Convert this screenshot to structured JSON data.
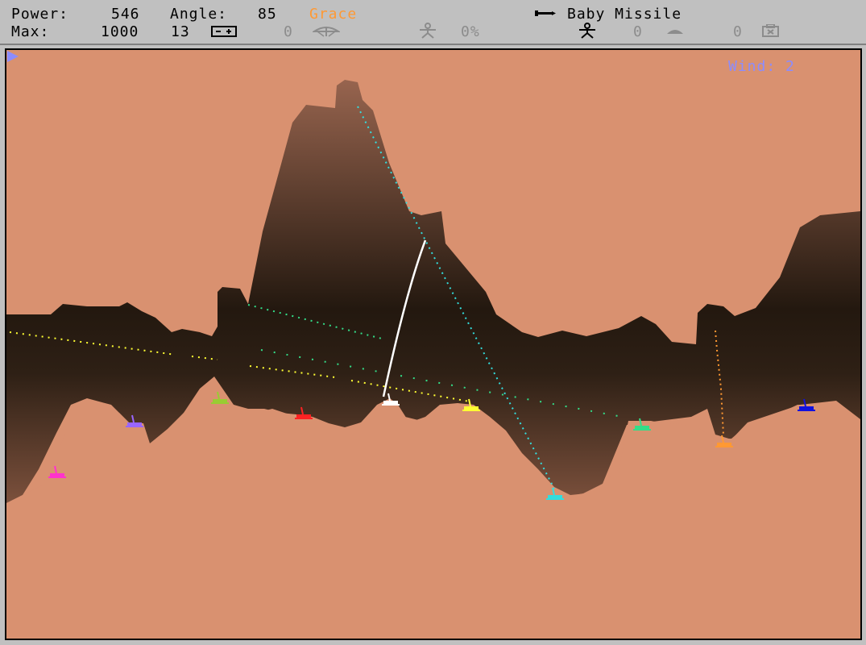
{
  "status": {
    "power_label": "Power:",
    "power_value": "546",
    "angle_label": "Angle:",
    "angle_value": "85",
    "player_name": "Grace",
    "player_color": "#ff9933",
    "weapon_name": "Baby Missile",
    "max_label": "Max:",
    "max_value": "1000",
    "battery_count": "13",
    "parachute_count": "0",
    "shield_percent": "0%",
    "fuel_count": "0",
    "tracer_count": "0",
    "inventory_count": "0",
    "icons": {
      "weapon": "missile-icon",
      "battery": "battery-icon",
      "parachute": "parachute-icon",
      "shield": "shield-person-icon",
      "player": "player-person-icon",
      "fuel": "fuel-icon",
      "inventory": "inventory-box-icon"
    }
  },
  "wind": {
    "label": "Wind:",
    "value": "2",
    "direction": "right"
  },
  "colors": {
    "sky": "#d99170",
    "ground": "#d99170",
    "mountain_top": "#9a6650",
    "mountain_mid": "#23180f",
    "mountain_bottom": "#5e3d2e",
    "wind_text": "#8c8cff"
  },
  "tanks": [
    {
      "name": "magenta-tank",
      "color": "#ff33cc"
    },
    {
      "name": "purple-tank",
      "color": "#9966ff"
    },
    {
      "name": "lime-tank",
      "color": "#99cc33"
    },
    {
      "name": "red-tank",
      "color": "#ff2222"
    },
    {
      "name": "white-tank",
      "color": "#ffffff"
    },
    {
      "name": "yellow-tank",
      "color": "#ffff33"
    },
    {
      "name": "cyan-tank",
      "color": "#33dddd"
    },
    {
      "name": "green-tank",
      "color": "#33dd88"
    },
    {
      "name": "orange-tank",
      "color": "#ff9933"
    },
    {
      "name": "blue-tank",
      "color": "#1111dd"
    }
  ]
}
